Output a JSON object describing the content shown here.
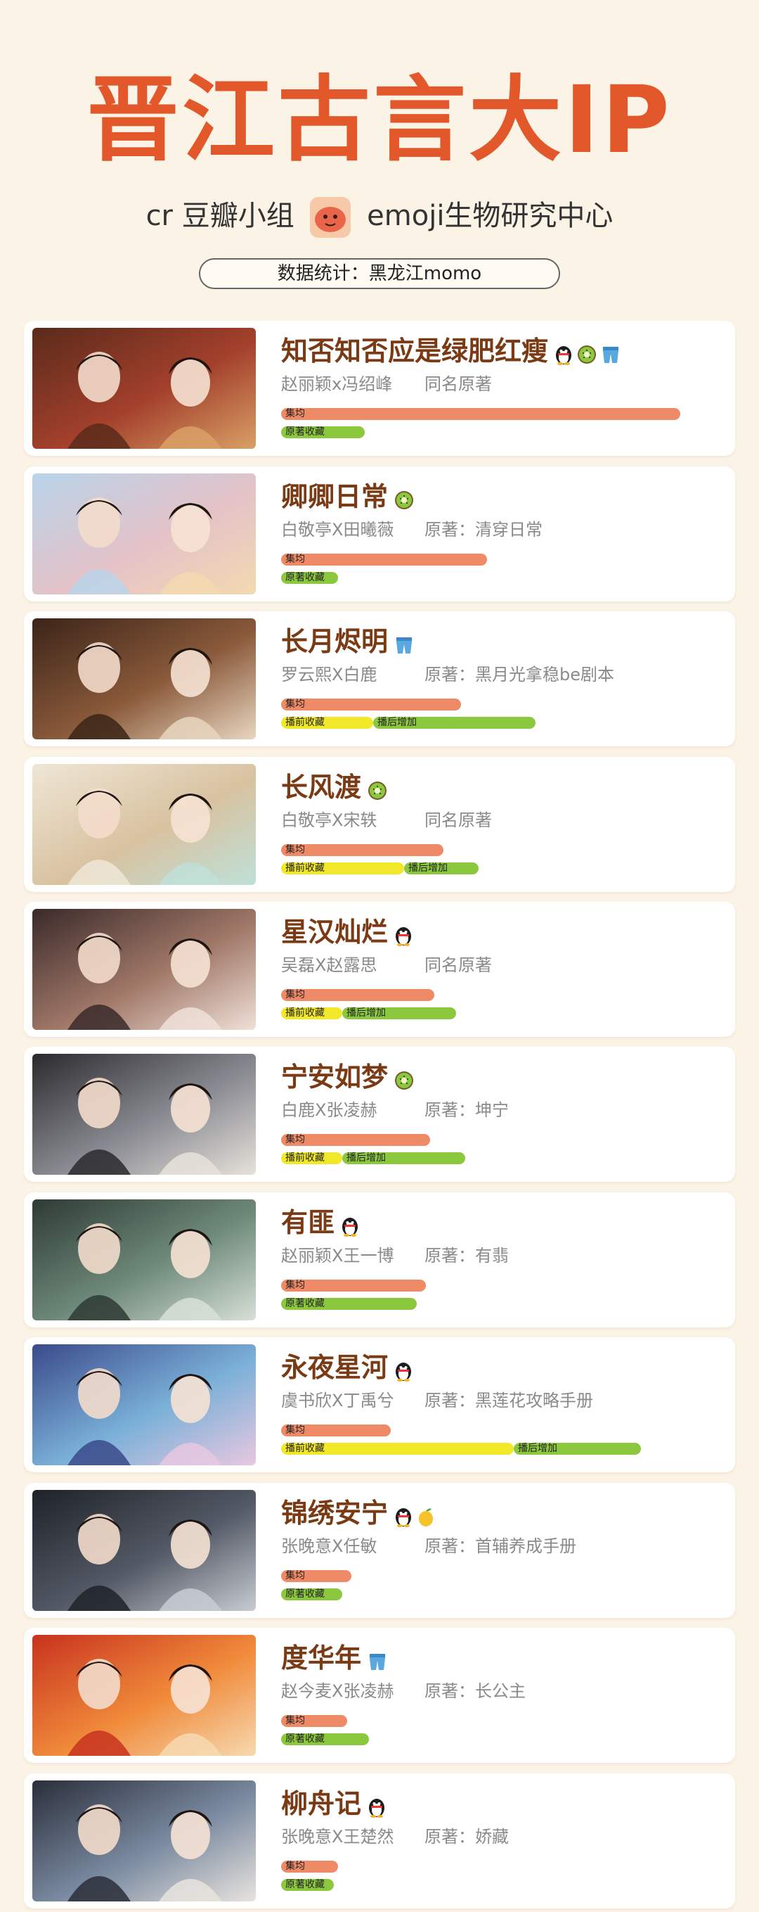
{
  "header": {
    "title": "晋江古言大IP",
    "credit_prefix": "cr 豆瓣小组",
    "credit_suffix": "emoji生物研究中心",
    "stats": "数据统计：黑龙江momo"
  },
  "labels": {
    "jifen": "集均",
    "yuanzhu": "原著收藏",
    "boqian": "播前收藏",
    "bohou": "播后增加"
  },
  "colors": {
    "title": "#e2582a",
    "jifen_bar": "#ef8a66",
    "yuanzhu_bar": "#8cc83e",
    "boqian_bar": "#f2e82a",
    "bohou_bar": "#8cc83e"
  },
  "cards": [
    {
      "title": "知否知否应是绿肥红瘦",
      "icons": [
        "penguin-icon",
        "kiwi-icon",
        "shorts-icon"
      ],
      "cast": "赵丽颖x冯绍峰",
      "source": "同名原著",
      "bars": {
        "jifen": 0.91,
        "yuanzhu": 0.19
      }
    },
    {
      "title": "卿卿日常",
      "icons": [
        "kiwi-icon"
      ],
      "cast": "白敬亭X田曦薇",
      "source": "原著：清穿日常",
      "bars": {
        "jifen": 0.47,
        "yuanzhu": 0.13
      }
    },
    {
      "title": "长月烬明",
      "icons": [
        "shorts-icon"
      ],
      "cast": "罗云熙X白鹿",
      "source": "原著：黑月光拿稳be剧本",
      "bars": {
        "jifen": 0.41,
        "boqian": 0.21,
        "bohou": 0.37
      }
    },
    {
      "title": "长风渡",
      "icons": [
        "kiwi-icon"
      ],
      "cast": "白敬亭X宋轶",
      "source": "同名原著",
      "bars": {
        "jifen": 0.37,
        "boqian": 0.28,
        "bohou": 0.17
      }
    },
    {
      "title": "星汉灿烂",
      "icons": [
        "penguin-icon"
      ],
      "cast": "吴磊X赵露思",
      "source": "同名原著",
      "bars": {
        "jifen": 0.35,
        "boqian": 0.14,
        "bohou": 0.26
      }
    },
    {
      "title": "宁安如梦",
      "icons": [
        "kiwi-icon"
      ],
      "cast": "白鹿X张凌赫",
      "source": "原著：坤宁",
      "bars": {
        "jifen": 0.34,
        "boqian": 0.14,
        "bohou": 0.28
      }
    },
    {
      "title": "有匪",
      "icons": [
        "penguin-icon"
      ],
      "cast": "赵丽颖X王一博",
      "source": "原著：有翡",
      "bars": {
        "jifen": 0.33,
        "yuanzhu": 0.31
      }
    },
    {
      "title": "永夜星河",
      "icons": [
        "penguin-icon"
      ],
      "cast": "虞书欣X丁禹兮",
      "source": "原著：黑莲花攻略手册",
      "bars": {
        "jifen": 0.25,
        "boqian": 0.53,
        "bohou": 0.29
      }
    },
    {
      "title": "锦绣安宁",
      "icons": [
        "penguin-icon",
        "mango-icon"
      ],
      "cast": "张晚意X任敏",
      "source": "原著：首辅养成手册",
      "bars": {
        "jifen": 0.16,
        "yuanzhu": 0.14
      }
    },
    {
      "title": "度华年",
      "icons": [
        "shorts-icon"
      ],
      "cast": "赵今麦X张凌赫",
      "source": "原著：长公主",
      "bars": {
        "jifen": 0.15,
        "yuanzhu": 0.2
      }
    },
    {
      "title": "柳舟记",
      "icons": [
        "penguin-icon"
      ],
      "cast": "张晚意X王楚然",
      "source": "原著：娇藏",
      "bars": {
        "jifen": 0.13,
        "yuanzhu": 0.12
      }
    }
  ]
}
